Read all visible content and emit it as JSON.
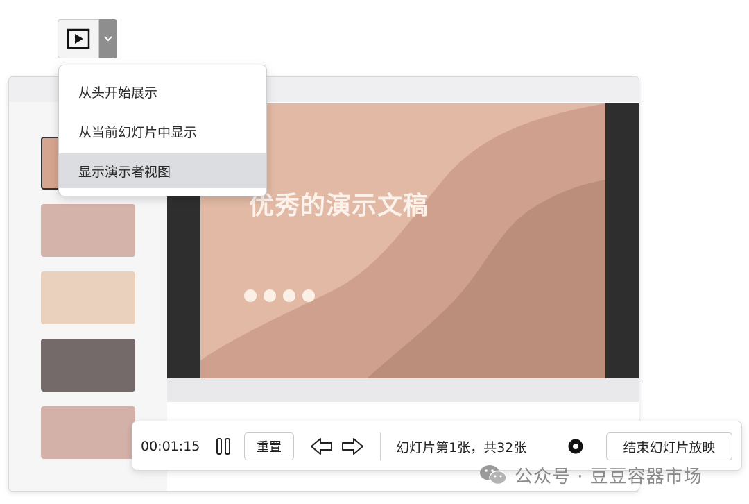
{
  "toolbar": {
    "play_icon": "play-icon",
    "caret_icon": "chevron-down-icon"
  },
  "dropdown": {
    "items": [
      {
        "label": "从头开始展示"
      },
      {
        "label": "从当前幻灯片中显示"
      },
      {
        "label": "显示演示者视图",
        "highlighted": true
      }
    ]
  },
  "slide": {
    "title": "优秀的演示文稿",
    "dots": 4,
    "colors": {
      "base": "#e1b9a4",
      "mid": "#cfa08d",
      "dark": "#bb8e7b"
    }
  },
  "thumbnails": [
    {
      "color": "#d5a58f",
      "selected": true
    },
    {
      "color": "#d4b3aa"
    },
    {
      "color": "#ead1be"
    },
    {
      "color": "#736a69"
    },
    {
      "color": "#d3b0a8"
    }
  ],
  "controls": {
    "timer": "00:01:15",
    "reset_label": "重置",
    "slide_counter": "幻灯片第1张，共32张",
    "end_show_label": "结束幻灯片放映",
    "icons": [
      "pause-icon",
      "prev-arrow-icon",
      "next-arrow-icon",
      "record-icon"
    ]
  },
  "watermark": {
    "text": "公众号 · 豆豆容器市场"
  }
}
